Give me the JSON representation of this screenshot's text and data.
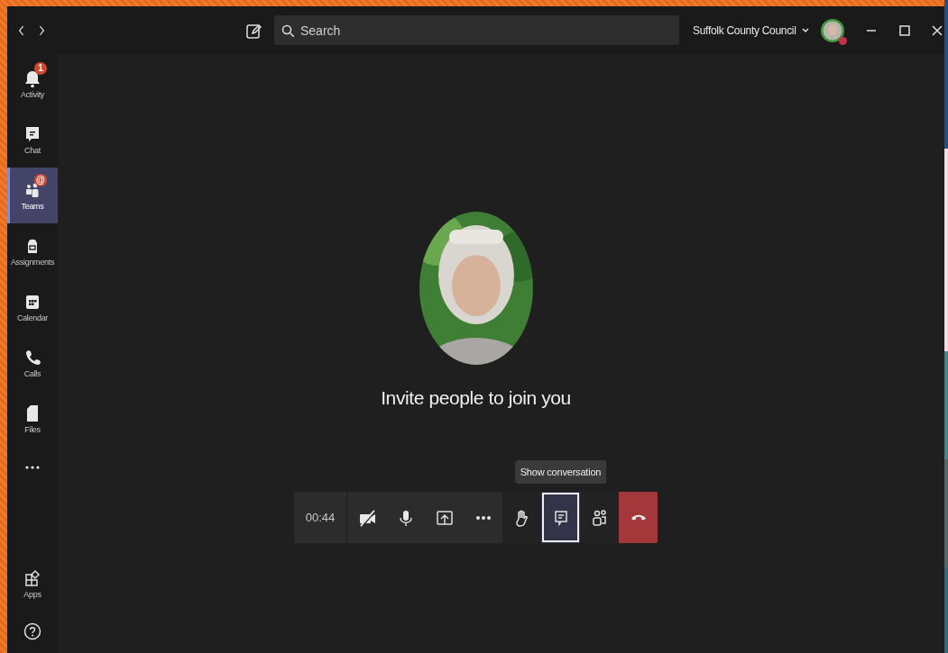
{
  "title_bar": {
    "search": {
      "placeholder": "Search"
    },
    "organization": "Suffolk County Council"
  },
  "sidebar": {
    "items": [
      {
        "kind": "activity",
        "label": "Activity",
        "selected": false,
        "badge": "1"
      },
      {
        "kind": "chat",
        "label": "Chat",
        "selected": false
      },
      {
        "kind": "teams",
        "label": "Teams",
        "selected": true,
        "badge": "@"
      },
      {
        "kind": "assignments",
        "label": "Assignments",
        "selected": false
      },
      {
        "kind": "calendar",
        "label": "Calendar",
        "selected": false
      },
      {
        "kind": "calls",
        "label": "Calls",
        "selected": false
      },
      {
        "kind": "files",
        "label": "Files",
        "selected": false
      },
      {
        "kind": "more",
        "selected": false
      }
    ],
    "bottom_items": [
      {
        "kind": "apps",
        "label": "Apps"
      },
      {
        "kind": "help"
      }
    ]
  },
  "call": {
    "message": "Invite people to join you",
    "timer": "00:44",
    "tooltip": "Show conversation",
    "controls": [
      {
        "kind": "camera",
        "on": false,
        "selected": false
      },
      {
        "kind": "mic",
        "on": true,
        "selected": false
      },
      {
        "kind": "share",
        "selected": false
      },
      {
        "kind": "more",
        "selected": false
      },
      {
        "kind": "hand",
        "selected": false
      },
      {
        "kind": "chat",
        "selected": true
      },
      {
        "kind": "people",
        "selected": false
      },
      {
        "kind": "hangup",
        "selected": false
      }
    ]
  }
}
